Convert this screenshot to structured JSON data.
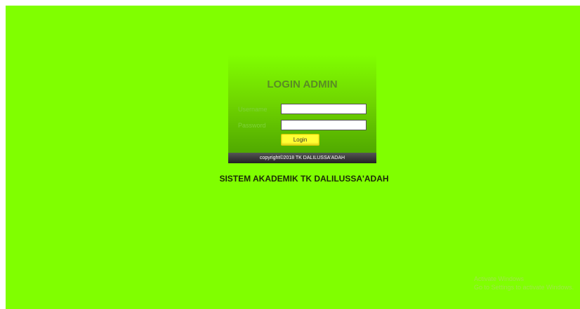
{
  "login": {
    "title": "LOGIN ADMIN",
    "username_label": "Username",
    "username_value": "",
    "password_label": "Password",
    "password_value": "",
    "button_label": "Login",
    "copyright": "copyright©2018 TK DALILUSSA'ADAH"
  },
  "system_title": "SISTEM AKADEMIK TK DALILUSSA'ADAH",
  "watermark": {
    "line1": "Activate Windows",
    "line2": "Go to Settings to activate Windows."
  },
  "colors": {
    "background": "#80ff00",
    "footer": "#2a2a2a",
    "button": "#ffff33"
  }
}
